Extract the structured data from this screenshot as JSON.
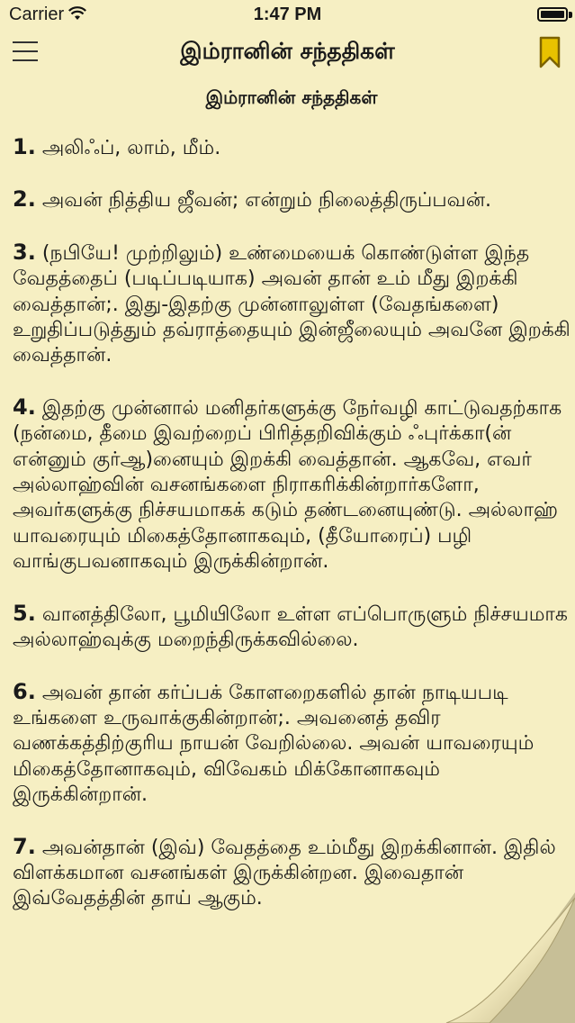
{
  "status_bar": {
    "carrier": "Carrier",
    "time": "1:47 PM"
  },
  "nav": {
    "title": "இம்ரானின் சந்ததிகள்"
  },
  "chapter": {
    "heading": "இம்ரானின் சந்ததிகள்"
  },
  "verses": [
    {
      "number": "1.",
      "text": "அலிஃப், லாம், மீம்."
    },
    {
      "number": "2.",
      "text": "அவன் நித்திய ஜீவன்; என்றும் நிலைத்திருப்பவன்."
    },
    {
      "number": "3.",
      "text": "(நபியே! முற்றிலும்) உண்மையைக் கொண்டுள்ள இந்த வேதத்தைப் (படிப்படியாக) அவன் தான் உம் மீது இறக்கி வைத்தான்;. இது-இதற்கு முன்னாலுள்ள (வேதங்களை) உறுதிப்படுத்தும் தவ்ராத்தையும் இன்ஜீலையும் அவனே இறக்கி வைத்தான்."
    },
    {
      "number": "4.",
      "text": "இதற்கு முன்னால் மனிதர்களுக்கு நேர்வழி காட்டுவதற்காக (நன்மை, தீமை இவற்றைப் பிரித்தறிவிக்கும் ஃபுர்க்கா(ன் என்னும் குர்ஆ)னையும் இறக்கி வைத்தான். ஆகவே, எவர் அல்லாஹ்வின் வசனங்களை நிராகரிக்கின்றார்களோ, அவர்களுக்கு நிச்சயமாகக் கடும் தண்டனையுண்டு. அல்லாஹ் யாவரையும் மிகைத்தோனாகவும், (தீயோரைப்) பழி வாங்குபவனாகவும் இருக்கின்றான்."
    },
    {
      "number": "5.",
      "text": "வானத்திலோ, பூமியிலோ உள்ள எப்பொருளும் நிச்சயமாக அல்லாஹ்வுக்கு மறைந்திருக்கவில்லை."
    },
    {
      "number": "6.",
      "text": "அவன் தான் கர்ப்பக் கோளறைகளில் தான் நாடியபடி உங்களை உருவாக்குகின்றான்;. அவனைத் தவிர வணக்கத்திற்குரிய நாயன் வேறில்லை. அவன் யாவரையும் மிகைத்தோனாகவும், விவேகம் மிக்கோனாகவும் இருக்கின்றான்."
    },
    {
      "number": "7.",
      "text": "அவன்தான் (இவ்) வேதத்தை உம்மீது இறக்கினான். இதில் விளக்கமான வசனங்கள் இருக்கின்றன. இவைதான் இவ்வேதத்தின் தாய் ஆகும்."
    }
  ]
}
